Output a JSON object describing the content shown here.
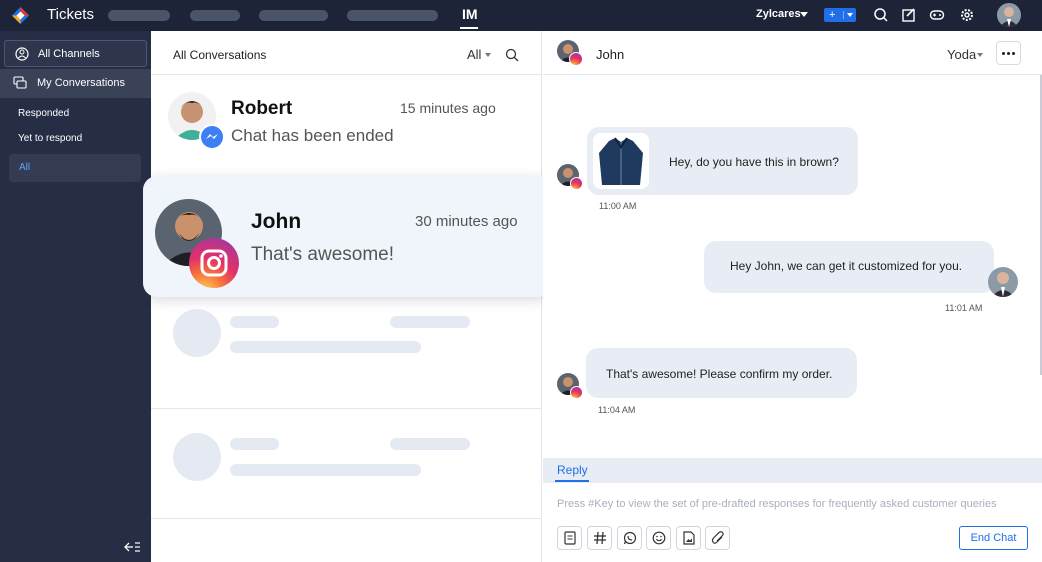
{
  "topbar": {
    "app_title": "Tickets",
    "active_tab": "IM",
    "org_name": "Zylcares",
    "add_label": "+"
  },
  "sidebar": {
    "all_channels": "All Channels",
    "my_conversations": "My Conversations",
    "sub_items": [
      "Responded",
      "Yet to respond",
      "All"
    ]
  },
  "list": {
    "title": "All Conversations",
    "filter": "All",
    "conversations": [
      {
        "name": "Robert",
        "time": "15 minutes ago",
        "preview": "Chat has been ended",
        "channel": "messenger-icon"
      },
      {
        "name": "John",
        "time": "30 minutes ago",
        "preview": "That's awesome!",
        "channel": "instagram-icon"
      }
    ]
  },
  "chat": {
    "contact_name": "John",
    "assignee": "Yoda",
    "messages": [
      {
        "direction": "incoming",
        "text": "Hey, do you have this in brown?",
        "time": "11:00 AM",
        "attachment": "jacket-image"
      },
      {
        "direction": "outgoing",
        "text": "Hey John, we can get it customized for you.",
        "time": "11:01 AM"
      },
      {
        "direction": "incoming",
        "text": "That's awesome! Please confirm my order.",
        "time": "11:04 AM"
      }
    ],
    "reply_tab": "Reply",
    "reply_placeholder": "Press #Key to view the set of pre-drafted responses for frequently asked customer queries",
    "end_chat_label": "End Chat",
    "tools": [
      "template-icon",
      "hashtag-icon",
      "whatsapp-icon",
      "emoji-icon",
      "image-icon",
      "attachment-icon"
    ]
  },
  "colors": {
    "topbar": "#1d2438",
    "sidebar": "#262e45",
    "accent": "#1f6fe8",
    "bubble": "#e8edf5",
    "card_highlight": "#f0f5fb"
  }
}
